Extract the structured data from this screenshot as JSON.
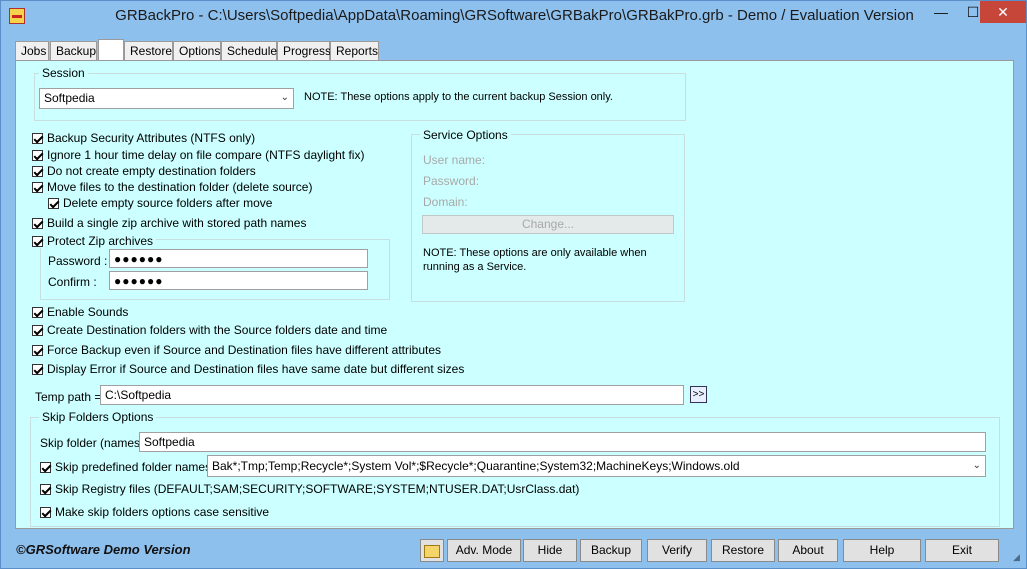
{
  "window": {
    "title": "GRBackPro - C:\\Users\\Softpedia\\AppData\\Roaming\\GRSoftware\\GRBakPro\\GRBakPro.grb - Demo / Evaluation Version",
    "minimize": "—",
    "maximize": "☐",
    "close": "✕"
  },
  "tabs": [
    "Jobs",
    "Backup",
    "",
    "Restore",
    "Options",
    "Schedule",
    "Progress",
    "Reports"
  ],
  "session": {
    "group_label": "Session",
    "selected": "Softpedia",
    "note": "NOTE: These options apply to the current backup Session only."
  },
  "options": {
    "backup_security": "Backup Security Attributes (NTFS only)",
    "ignore_delay": "Ignore 1 hour time delay on file compare (NTFS daylight fix)",
    "no_empty_folders": "Do not create empty destination folders",
    "move_files": "Move files to the destination folder (delete source)",
    "delete_empty_source": "Delete empty source folders after move",
    "single_zip": "Build a single zip archive with stored path names",
    "protect_zip": "Protect Zip archives",
    "password_label": "Password :",
    "password_value": "●●●●●●",
    "confirm_label": "Confirm :",
    "confirm_value": "●●●●●●",
    "enable_sounds": "Enable Sounds",
    "create_dest_date": "Create Destination folders with the Source folders date and time",
    "force_backup": "Force Backup even if Source and Destination files have different attributes",
    "display_error": "Display Error if Source and Destination files have same date but different sizes",
    "temp_path_label": "Temp path =",
    "temp_path_value": "C:\\Softpedia",
    "browse_button": ">>"
  },
  "service": {
    "group_label": "Service Options",
    "user_name": "User name:",
    "password": "Password:",
    "domain": "Domain:",
    "change_button": "Change...",
    "note": "NOTE: These options are only available when running as a Service."
  },
  "skip": {
    "group_label": "Skip Folders Options",
    "folder_label": "Skip folder (names):",
    "folder_value": "Softpedia",
    "predefined_label": "Skip predefined folder names:",
    "predefined_value": "Bak*;Tmp;Temp;Recycle*;System Vol*;$Recycle*;Quarantine;System32;MachineKeys;Windows.old",
    "registry": "Skip Registry files (DEFAULT;SAM;SECURITY;SOFTWARE;SYSTEM;NTUSER.DAT;UsrClass.dat)",
    "case_sensitive": "Make skip folders options case sensitive"
  },
  "footer": {
    "copyright": "©GRSoftware Demo Version",
    "buttons": [
      "Adv. Mode",
      "Hide",
      "Backup",
      "Verify",
      "Restore",
      "About",
      "Help",
      "Exit"
    ]
  }
}
